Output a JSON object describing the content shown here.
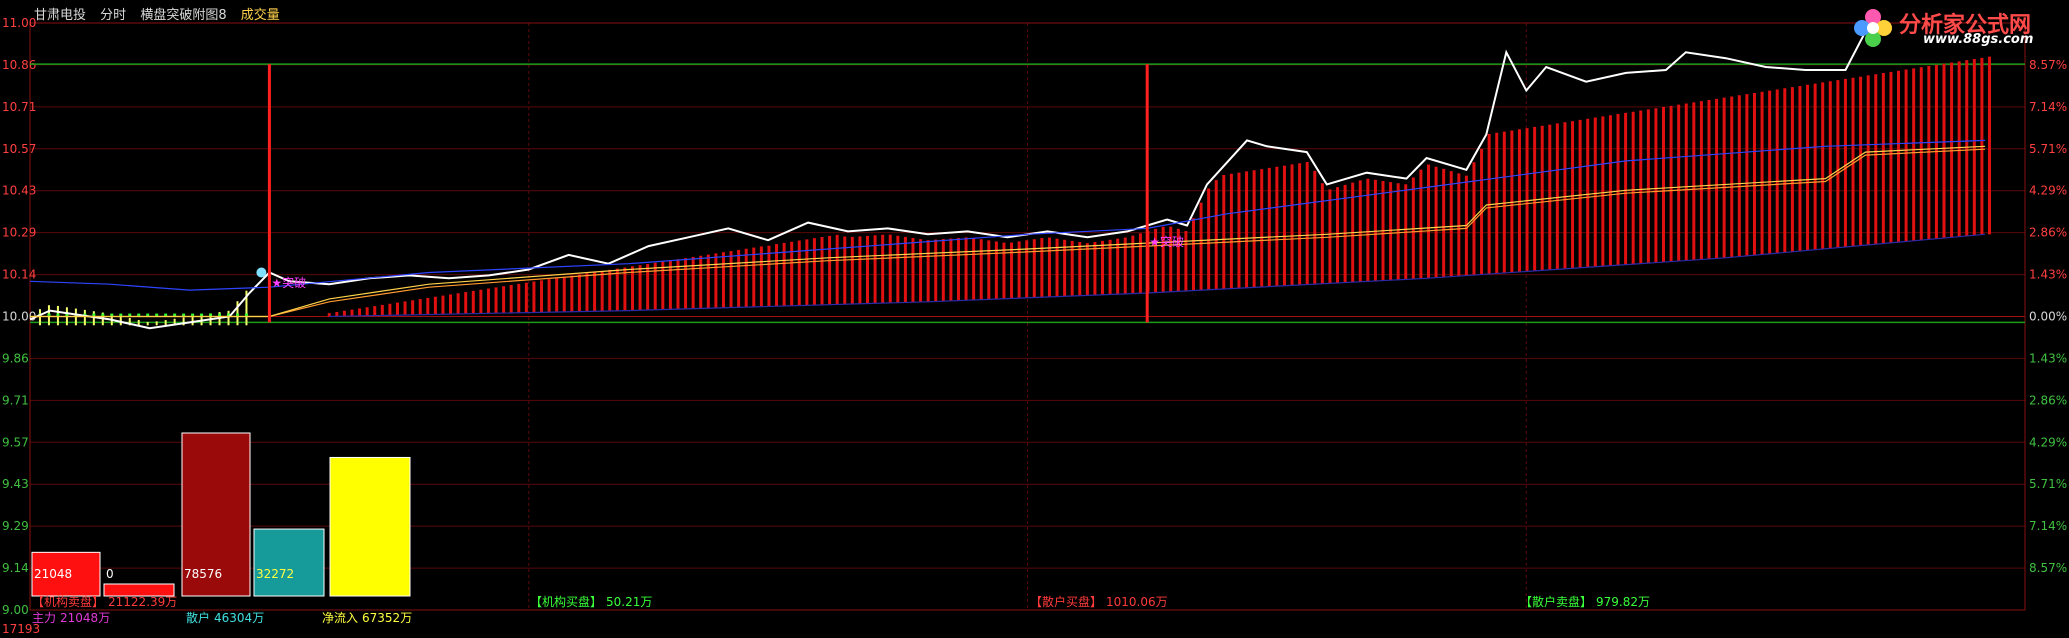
{
  "header": {
    "stock_name": "甘肃电投",
    "period": "分时",
    "indicator_name": "横盘突破附图8",
    "volume_label": "成交量"
  },
  "logo": {
    "name": "分析家公式网",
    "url": "www.88gs.com"
  },
  "chart_data": [
    {
      "type": "line",
      "title": "",
      "y_axis_left": {
        "range": [
          9.0,
          11.0
        ],
        "ticks": [
          "11.00",
          "10.86",
          "10.71",
          "10.57",
          "10.43",
          "10.29",
          "10.14",
          "10.00",
          "9.86",
          "9.71",
          "9.57",
          "9.43",
          "9.29",
          "9.14",
          "9.00"
        ]
      },
      "y_axis_right": {
        "ticks": [
          "8.57%",
          "7.14%",
          "5.71%",
          "4.29%",
          "2.86%",
          "1.43%",
          "0.00%",
          "1.43%",
          "2.86%",
          "4.29%",
          "5.71%",
          "7.14%",
          "8.57%"
        ]
      },
      "bottom_value": "17193",
      "grid": true,
      "reference_lines": [
        {
          "name": "upper-green",
          "value": 10.86,
          "color": "#1a9c1a"
        },
        {
          "name": "lower-green",
          "value": 9.98,
          "color": "#1a9c1a"
        }
      ],
      "markers": [
        {
          "x": 0.12,
          "label": "突破"
        },
        {
          "x": 0.56,
          "label": "突破"
        }
      ],
      "series": [
        {
          "color": "#ffffff",
          "points": [
            [
              0,
              9.99
            ],
            [
              0.01,
              10.02
            ],
            [
              0.02,
              10.01
            ],
            [
              0.04,
              9.99
            ],
            [
              0.06,
              9.96
            ],
            [
              0.08,
              9.98
            ],
            [
              0.1,
              10.0
            ],
            [
              0.11,
              10.08
            ],
            [
              0.12,
              10.15
            ],
            [
              0.13,
              10.12
            ],
            [
              0.15,
              10.11
            ],
            [
              0.17,
              10.13
            ],
            [
              0.19,
              10.14
            ],
            [
              0.21,
              10.13
            ],
            [
              0.23,
              10.14
            ],
            [
              0.25,
              10.16
            ],
            [
              0.27,
              10.21
            ],
            [
              0.29,
              10.18
            ],
            [
              0.31,
              10.24
            ],
            [
              0.33,
              10.27
            ],
            [
              0.35,
              10.3
            ],
            [
              0.37,
              10.26
            ],
            [
              0.39,
              10.32
            ],
            [
              0.41,
              10.29
            ],
            [
              0.43,
              10.3
            ],
            [
              0.45,
              10.28
            ],
            [
              0.47,
              10.29
            ],
            [
              0.49,
              10.27
            ],
            [
              0.51,
              10.29
            ],
            [
              0.53,
              10.27
            ],
            [
              0.55,
              10.29
            ],
            [
              0.56,
              10.31
            ],
            [
              0.57,
              10.33
            ],
            [
              0.58,
              10.31
            ],
            [
              0.59,
              10.45
            ],
            [
              0.61,
              10.6
            ],
            [
              0.62,
              10.58
            ],
            [
              0.64,
              10.56
            ],
            [
              0.65,
              10.45
            ],
            [
              0.67,
              10.49
            ],
            [
              0.69,
              10.47
            ],
            [
              0.7,
              10.54
            ],
            [
              0.72,
              10.5
            ],
            [
              0.73,
              10.62
            ],
            [
              0.74,
              10.9
            ],
            [
              0.75,
              10.77
            ],
            [
              0.76,
              10.85
            ],
            [
              0.78,
              10.8
            ],
            [
              0.8,
              10.83
            ],
            [
              0.82,
              10.84
            ],
            [
              0.83,
              10.9
            ],
            [
              0.85,
              10.88
            ],
            [
              0.87,
              10.85
            ],
            [
              0.89,
              10.84
            ],
            [
              0.91,
              10.84
            ],
            [
              0.92,
              10.97
            ],
            [
              0.93,
              11.0
            ]
          ]
        },
        {
          "color": "#2e44ff",
          "points": [
            [
              0,
              10.12
            ],
            [
              0.04,
              10.11
            ],
            [
              0.08,
              10.09
            ],
            [
              0.12,
              10.1
            ],
            [
              0.2,
              10.15
            ],
            [
              0.3,
              10.18
            ],
            [
              0.4,
              10.23
            ],
            [
              0.5,
              10.28
            ],
            [
              0.56,
              10.3
            ],
            [
              0.6,
              10.35
            ],
            [
              0.7,
              10.44
            ],
            [
              0.8,
              10.53
            ],
            [
              0.9,
              10.58
            ],
            [
              0.98,
              10.6
            ]
          ]
        },
        {
          "color": "#ff9a2e",
          "points": [
            [
              0,
              10.0
            ],
            [
              0.12,
              10.0
            ],
            [
              0.15,
              10.05
            ],
            [
              0.2,
              10.1
            ],
            [
              0.3,
              10.15
            ],
            [
              0.4,
              10.19
            ],
            [
              0.5,
              10.22
            ],
            [
              0.56,
              10.24
            ],
            [
              0.65,
              10.27
            ],
            [
              0.72,
              10.3
            ],
            [
              0.73,
              10.37
            ],
            [
              0.8,
              10.42
            ],
            [
              0.9,
              10.46
            ],
            [
              0.92,
              10.55
            ],
            [
              0.98,
              10.57
            ]
          ]
        },
        {
          "color": "#ffd24a",
          "points": [
            [
              0,
              10.0
            ],
            [
              0.12,
              10.0
            ],
            [
              0.15,
              10.06
            ],
            [
              0.2,
              10.11
            ],
            [
              0.3,
              10.16
            ],
            [
              0.4,
              10.2
            ],
            [
              0.5,
              10.23
            ],
            [
              0.56,
              10.25
            ],
            [
              0.65,
              10.28
            ],
            [
              0.72,
              10.31
            ],
            [
              0.73,
              10.38
            ],
            [
              0.8,
              10.43
            ],
            [
              0.9,
              10.47
            ],
            [
              0.92,
              10.56
            ],
            [
              0.98,
              10.58
            ]
          ]
        },
        {
          "color": "#2a2aa8",
          "points": [
            [
              0.15,
              10.0
            ],
            [
              0.3,
              10.02
            ],
            [
              0.45,
              10.05
            ],
            [
              0.56,
              10.08
            ],
            [
              0.7,
              10.13
            ],
            [
              0.85,
              10.2
            ],
            [
              0.98,
              10.28
            ]
          ]
        }
      ]
    },
    {
      "type": "bar",
      "categories": [
        "机构买盘",
        "机构卖盘",
        "散户买盘",
        "散户卖盘",
        "净流入"
      ],
      "values": [
        21048,
        0,
        78576,
        32272,
        67352
      ],
      "value_labels": [
        "21048",
        "0",
        "78576",
        "32272",
        ""
      ],
      "colors": [
        "#ff1010",
        "#ff1010",
        "#9a0a0a",
        "#169a9a",
        "#ffff00"
      ]
    }
  ],
  "legend_rows": [
    {
      "key": "机构卖盘",
      "bracket_label": "【机构卖盘】",
      "value": "21122.39万",
      "color": "#ff3a3a"
    },
    {
      "key": "主力",
      "label": "主力",
      "value": "21048万",
      "color": "#e23ad8"
    },
    {
      "key": "散户",
      "label": "散户",
      "value": "46304万",
      "color": "#40e0e0"
    },
    {
      "key": "净流入",
      "label": "净流入",
      "value": "67352万",
      "color": "#ffff40"
    },
    {
      "key": "机构买盘2",
      "bracket_label": "【机构买盘】",
      "value": "50.21万",
      "color": "#3aff3a"
    },
    {
      "key": "散户买盘",
      "bracket_label": "【散户买盘】",
      "value": "1010.06万",
      "color": "#ff3a3a"
    },
    {
      "key": "散户卖盘",
      "bracket_label": "【散户卖盘】",
      "value": "979.82万",
      "color": "#3aff3a"
    }
  ]
}
